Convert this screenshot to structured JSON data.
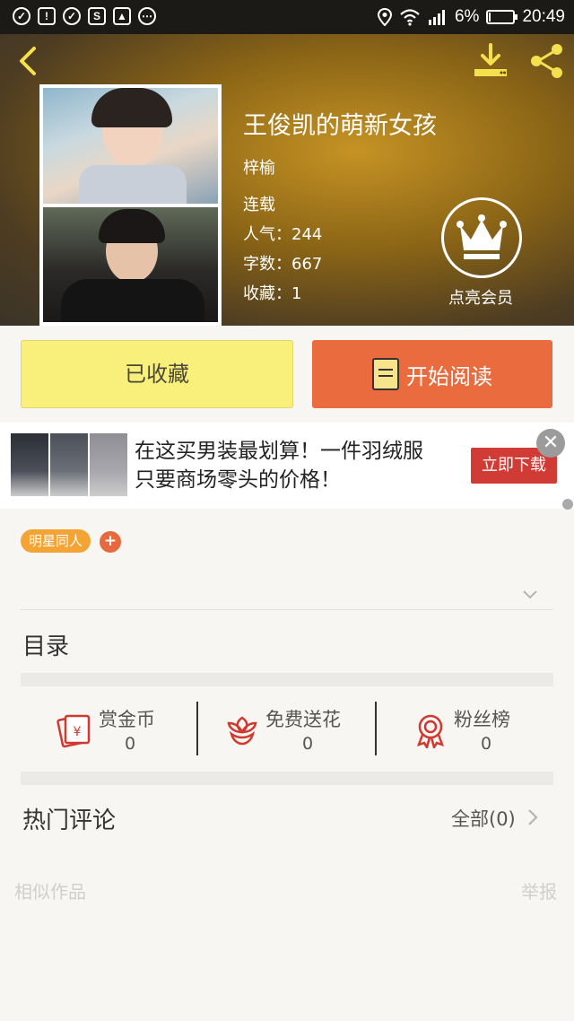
{
  "status_bar": {
    "battery": "6%",
    "time": "20:49",
    "battery_fraction": 0.06
  },
  "book": {
    "title": "王俊凯的萌新女孩",
    "author": "梓榆",
    "status": "连载",
    "popularity_label": "人气：",
    "popularity": "244",
    "words_label": "字数：",
    "words": "667",
    "favorites_label": "收藏：",
    "favorites": "1"
  },
  "member": {
    "label": "点亮会员",
    "icon": "crown-icon"
  },
  "actions": {
    "collected_label": "已收藏",
    "read_label": "开始阅读"
  },
  "ad": {
    "line1": "在这买男装最划算！一件羽绒服",
    "line2": "只要商场零头的价格！",
    "button": "立即下载"
  },
  "tags": [
    "明星同人"
  ],
  "tag_add": "+",
  "toc_title": "目录",
  "stats": [
    {
      "label": "赏金币",
      "value": "0",
      "icon": "red-envelope-icon"
    },
    {
      "label": "免费送花",
      "value": "0",
      "icon": "flower-icon"
    },
    {
      "label": "粉丝榜",
      "value": "0",
      "icon": "medal-icon"
    }
  ],
  "comments": {
    "title": "热门评论",
    "all_label": "全部(0)"
  },
  "footer": {
    "similar": "相似作品",
    "report": "举报"
  },
  "colors": {
    "collected_bg": "#f9ef7b",
    "read_bg": "#ea6b3d",
    "tag_bg": "#f3a434",
    "accent_red": "#d13b35"
  }
}
